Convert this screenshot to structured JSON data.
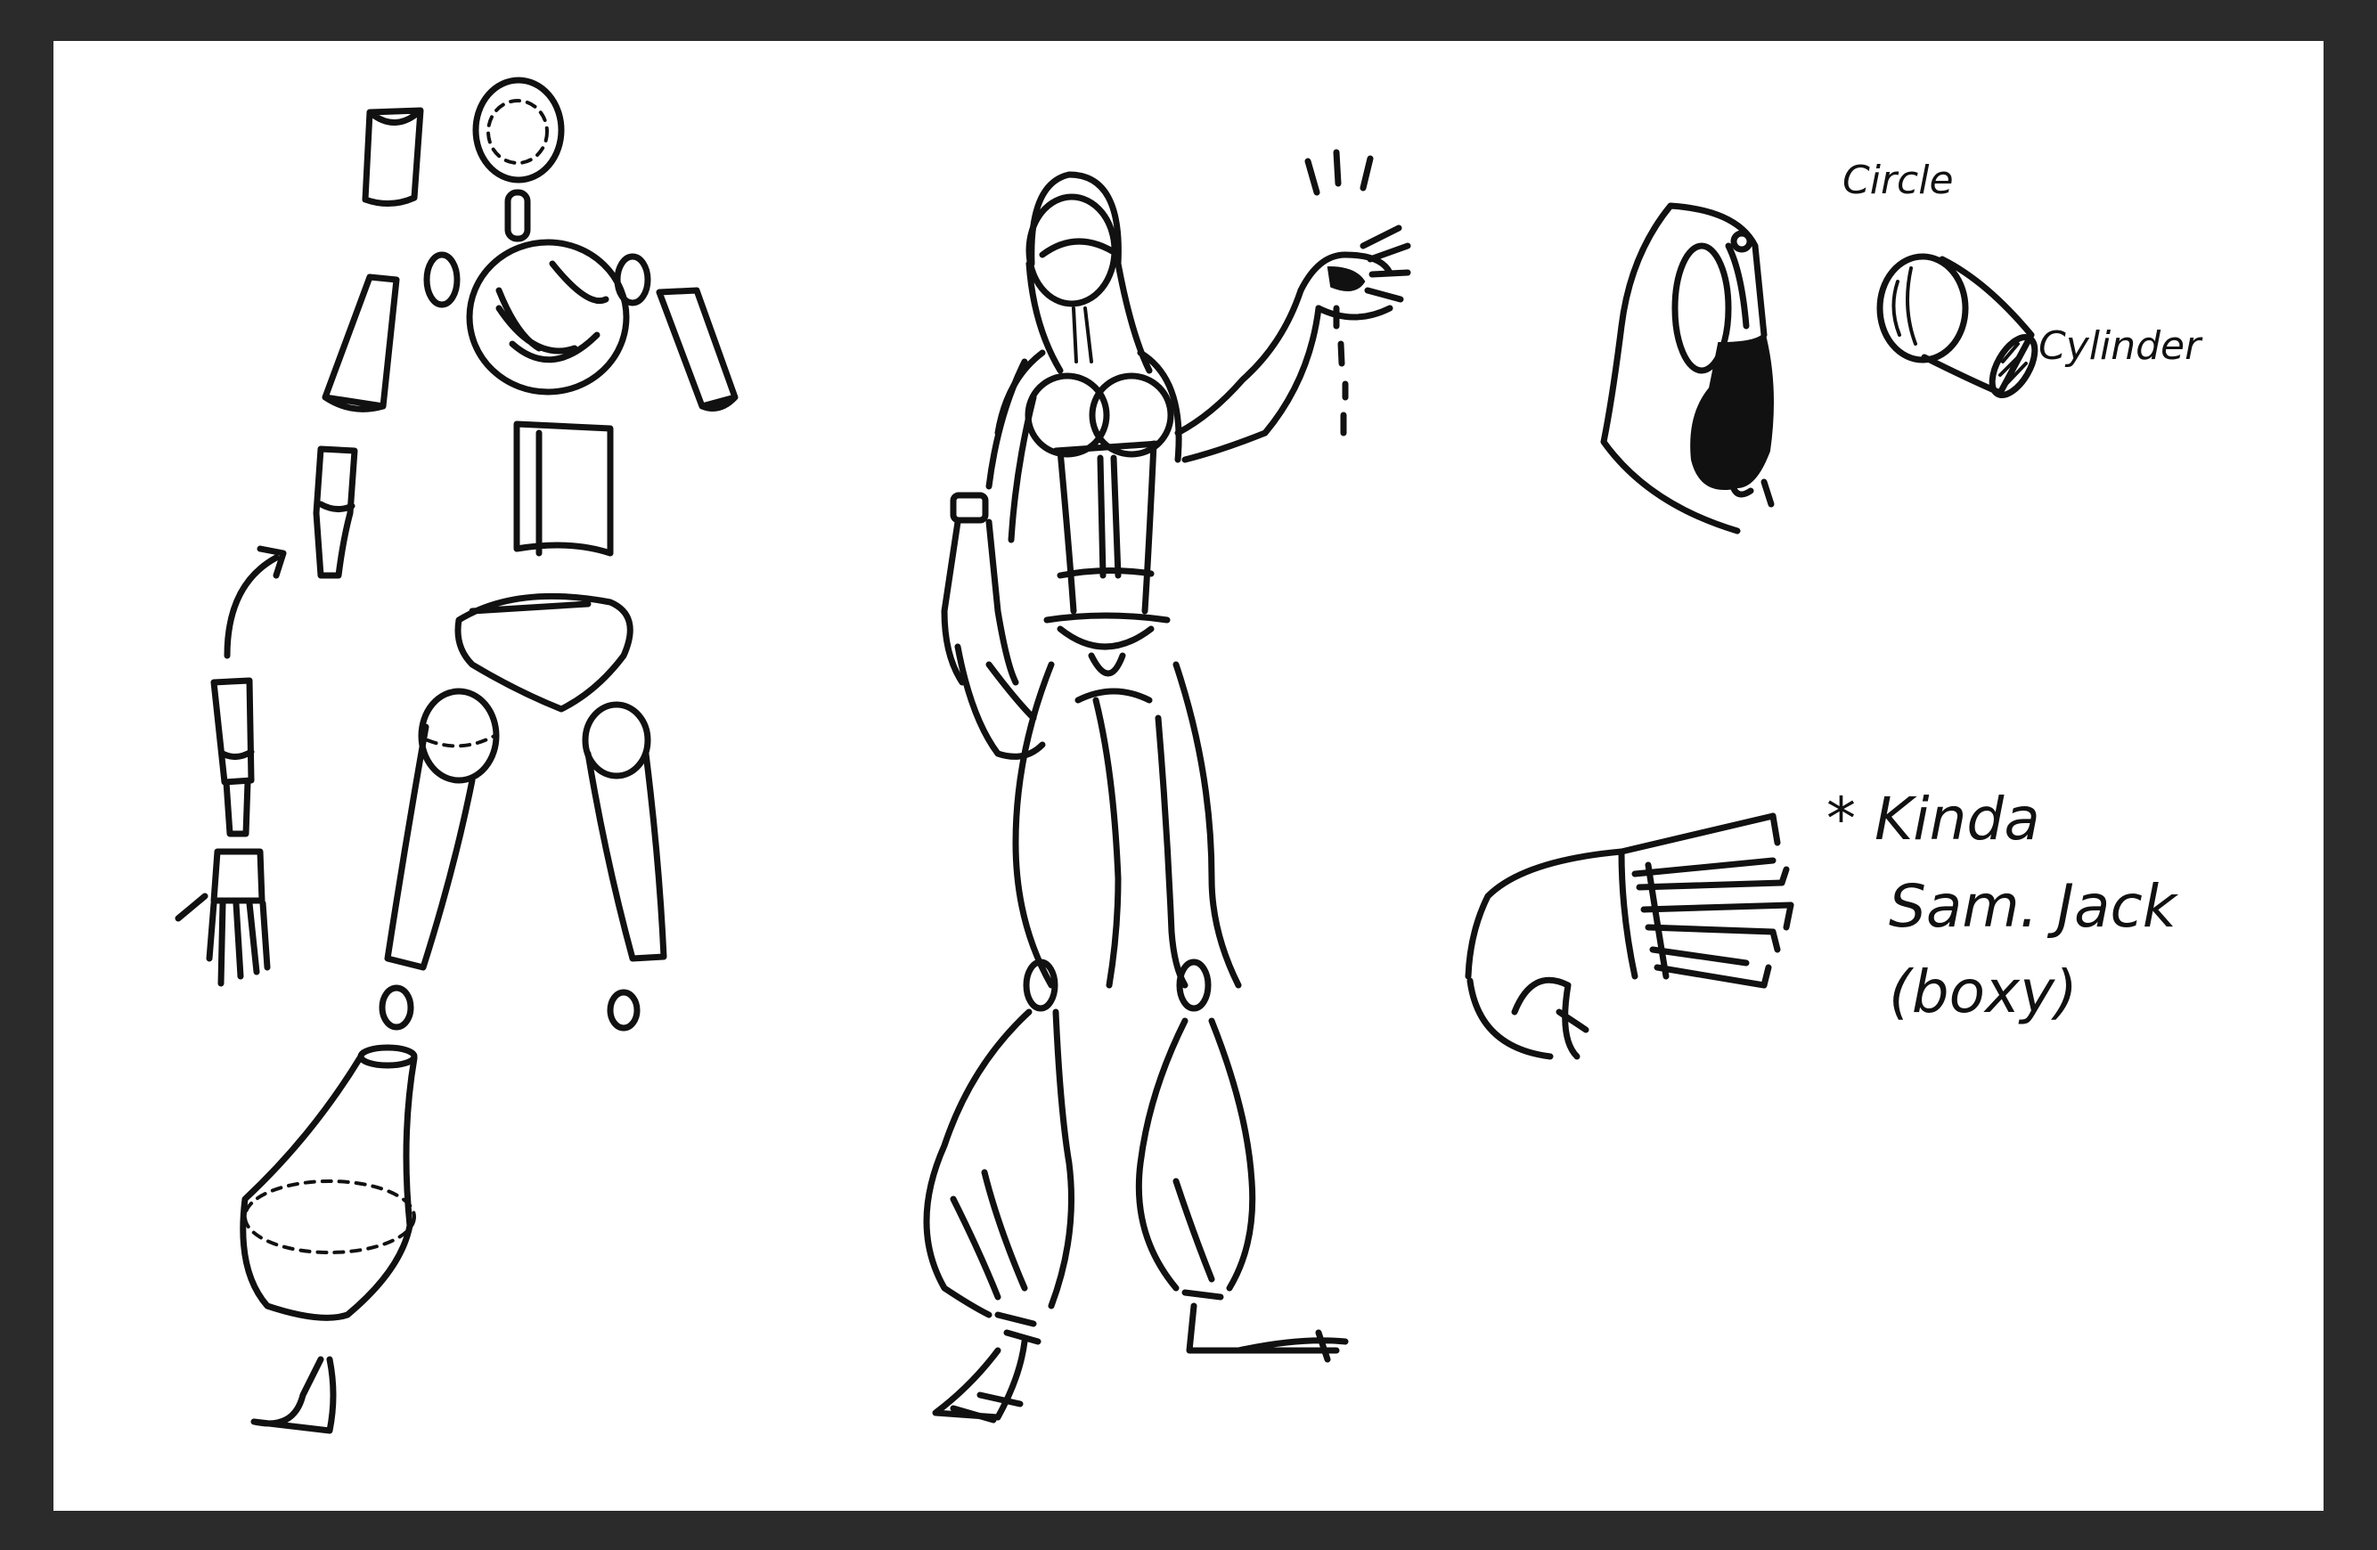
{
  "colors": {
    "frame": "#2b2b2b",
    "paper": "#ffffff",
    "ink": "#111111"
  },
  "annotations": {
    "circle": "Circle",
    "cylinder": "Cylinder",
    "kinda_line1": "* Kinda",
    "kinda_line2": "Sam. Jack",
    "kinda_line3": "(boxy)"
  }
}
